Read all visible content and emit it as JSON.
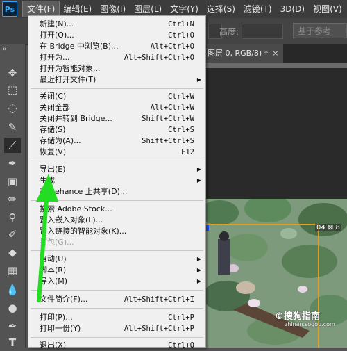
{
  "app": {
    "logo": "Ps"
  },
  "menubar": {
    "items": [
      "文件(F)",
      "编辑(E)",
      "图像(I)",
      "图层(L)",
      "文字(Y)",
      "选择(S)",
      "滤镜(T)",
      "3D(D)",
      "视图(V)"
    ]
  },
  "options_bar": {
    "height_label": "高度:",
    "reference_label": "基于参考"
  },
  "document": {
    "tab_title": "图层 0, RGB/8) *",
    "tab_close": "×",
    "photo_badge": "04 ⊠ 8"
  },
  "watermark": {
    "text": "©搜狗指南",
    "sub": "zhinan.sogou.com"
  },
  "file_menu": {
    "items": [
      {
        "label": "新建(N)...",
        "shortcut": "Ctrl+N"
      },
      {
        "label": "打开(O)...",
        "shortcut": "Ctrl+O"
      },
      {
        "label": "在 Bridge 中浏览(B)...",
        "shortcut": "Alt+Ctrl+O"
      },
      {
        "label": "打开为...",
        "shortcut": "Alt+Shift+Ctrl+O"
      },
      {
        "label": "打开为智能对象..."
      },
      {
        "label": "最近打开文件(T)",
        "submenu": true
      },
      {
        "label": "关闭(C)",
        "shortcut": "Ctrl+W"
      },
      {
        "label": "关闭全部",
        "shortcut": "Alt+Ctrl+W"
      },
      {
        "label": "关闭并转到 Bridge...",
        "shortcut": "Shift+Ctrl+W"
      },
      {
        "label": "存储(S)",
        "shortcut": "Ctrl+S"
      },
      {
        "label": "存储为(A)...",
        "shortcut": "Shift+Ctrl+S"
      },
      {
        "label": "恢复(V)",
        "shortcut": "F12"
      },
      {
        "label": "导出(E)",
        "submenu": true
      },
      {
        "label": "生成",
        "submenu": true
      },
      {
        "label": "在 Behance 上共享(D)..."
      },
      {
        "label": "搜索 Adobe Stock..."
      },
      {
        "label": "置入嵌入对象(L)..."
      },
      {
        "label": "置入链接的智能对象(K)..."
      },
      {
        "label": "打包(G)...",
        "disabled": true
      },
      {
        "label": "自动(U)",
        "submenu": true
      },
      {
        "label": "脚本(R)",
        "submenu": true
      },
      {
        "label": "导入(M)",
        "submenu": true
      },
      {
        "label": "文件简介(F)...",
        "shortcut": "Alt+Shift+Ctrl+I"
      },
      {
        "label": "打印(P)...",
        "shortcut": "Ctrl+P"
      },
      {
        "label": "打印一份(Y)",
        "shortcut": "Alt+Shift+Ctrl+P"
      },
      {
        "label": "退出(X)",
        "shortcut": "Ctrl+Q"
      }
    ]
  },
  "tools": [
    "move-tool",
    "marquee-tool",
    "lasso-tool",
    "quick-select-tool",
    "crop-tool",
    "eyedropper-tool",
    "healing-tool",
    "brush-tool",
    "clone-stamp-tool",
    "history-brush-tool",
    "eraser-tool",
    "gradient-tool",
    "blur-tool",
    "dodge-tool",
    "pen-tool",
    "type-tool"
  ],
  "colors": {
    "annotation_arrow": "#22dd22",
    "menu_bg": "#f0f0f0",
    "ps_blue": "#31a8ff"
  }
}
